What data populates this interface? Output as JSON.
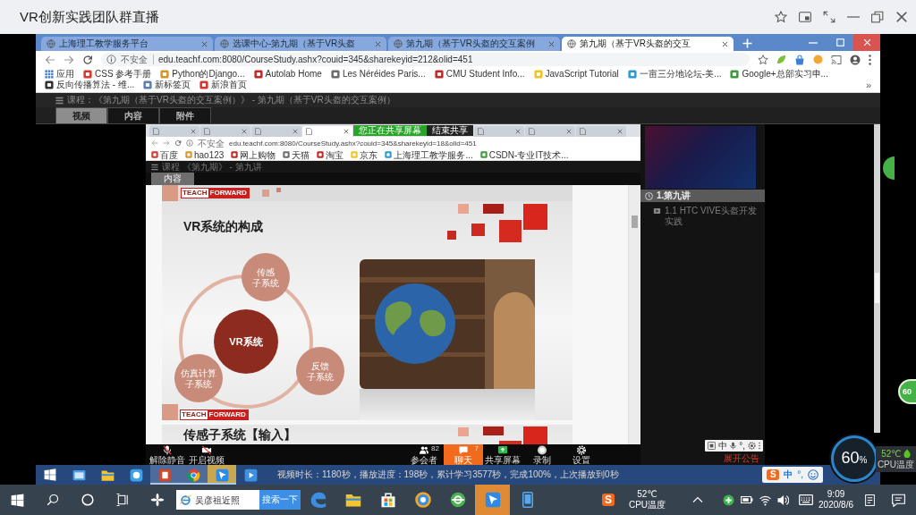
{
  "window": {
    "title": "VR创新实践团队群直播"
  },
  "browser": {
    "tabs": [
      {
        "title": "上海理工教学服务平台",
        "selected": false
      },
      {
        "title": "选课中心-第九期（基于VR头盔",
        "selected": false
      },
      {
        "title": "第九期（基于VR头盔的交互案例",
        "selected": false
      },
      {
        "title": "第九期（基于VR头盔的交互",
        "selected": true
      }
    ],
    "security_label": "不安全",
    "url": "edu.teachf.com:8080/CourseStudy.ashx?couid=345&sharekeyid=212&olid=451",
    "bookmarks": [
      {
        "label": "应用"
      },
      {
        "label": "CSS 参考手册"
      },
      {
        "label": "Python的Django..."
      },
      {
        "label": "Autolab Home"
      },
      {
        "label": "Les Néréides Paris..."
      },
      {
        "label": "CMU Student Info..."
      },
      {
        "label": "JavaScript Tutorial"
      },
      {
        "label": "一亩三分地论坛-美..."
      },
      {
        "label": "Google+总部实习申..."
      },
      {
        "label": "反向传播算法 - 维..."
      },
      {
        "label": "新标签页"
      },
      {
        "label": "新浪首页"
      }
    ],
    "more": "»"
  },
  "course_page": {
    "breadcrumb": "课程：《第九期（基于VR头盔的交互案例）》 - 第九期（基于VR头盔的交互案例）",
    "tabs": [
      {
        "label": "视频",
        "selected": true
      },
      {
        "label": "内容",
        "selected": false
      },
      {
        "label": "附件",
        "selected": false
      }
    ],
    "outline": {
      "chapter": "1.第九讲",
      "lessons": [
        {
          "title": "1.1 HTC VIVE头盔开发实践"
        }
      ]
    },
    "ime_toolbar": {
      "mode": "中",
      "punctuation": "°,"
    },
    "notice_link": "展开公告",
    "progress": "视频时长：1180秒，播放进度：198秒，累计学习3577秒，完成100%，上次播放到0秒"
  },
  "shared_screen": {
    "browser_tabs": [
      {
        "selected": false
      },
      {
        "selected": false
      },
      {
        "selected": false
      },
      {
        "selected": true
      },
      {
        "selected": false
      },
      {
        "selected": false
      },
      {
        "selected": false
      }
    ],
    "share_banner": {
      "text": "您正在共享屏幕",
      "button": "结束共享"
    },
    "security_label": "不安全",
    "url": "edu.teachf.com:8080/CourseStudy.ashx?couid=345&sharekeyid=18&olid=451",
    "bookmarks": [
      {
        "label": "百度"
      },
      {
        "label": "hao123"
      },
      {
        "label": "网上购物"
      },
      {
        "label": "天猫"
      },
      {
        "label": "淘宝"
      },
      {
        "label": "京东"
      },
      {
        "label": "上海理工教学服务..."
      },
      {
        "label": "CSDN-专业IT技术..."
      }
    ],
    "breadcrumb": "课程 《第九期》 - 第九讲",
    "tabs": [
      {
        "label": "内容",
        "selected": true
      }
    ],
    "slides": [
      {
        "header_logo": [
          "TEACH",
          "FORWARD"
        ],
        "title": "VR系统的构成",
        "diagram": {
          "center": "VR系统",
          "nodes": [
            {
              "lines": [
                "传感",
                "子系统"
              ]
            },
            {
              "lines": [
                "仿真计算",
                "子系统"
              ]
            },
            {
              "lines": [
                "反馈",
                "子系统"
              ]
            }
          ]
        },
        "footer_logo": [
          "TEACH",
          "FORWARD"
        ]
      },
      {
        "title": "传感子系统【输入】"
      }
    ]
  },
  "meeting_toolbar": {
    "items": [
      {
        "label": "解除静音",
        "selected": false
      },
      {
        "label": "开启视频",
        "selected": false
      },
      {
        "label": "参会者",
        "count": "82",
        "selected": false
      },
      {
        "label": "聊天",
        "count": "7",
        "selected": true
      },
      {
        "label": "共享屏幕",
        "selected": false
      },
      {
        "label": "录制",
        "selected": false
      },
      {
        "label": "设置",
        "selected": false
      }
    ]
  },
  "inner_taskbar": {
    "apps": [
      {
        "open": false,
        "selected": false
      },
      {
        "open": false,
        "selected": false
      },
      {
        "open": false,
        "selected": false
      },
      {
        "open": true,
        "selected": false
      },
      {
        "open": true,
        "selected": false
      },
      {
        "open": true,
        "selected": true
      },
      {
        "open": false,
        "selected": false
      }
    ],
    "ime": {
      "logo": "S",
      "mode": "中",
      "punctuation": "°,"
    }
  },
  "side_ball": {
    "label": "60"
  },
  "cpu_monitor": {
    "usage": "60",
    "unit": "%",
    "temperature": "52℃",
    "label": "CPU温度"
  },
  "taskbar": {
    "search": {
      "placeholder": "吴彦祖近照",
      "button": "搜索一下"
    },
    "apps": [
      {
        "selected": false
      },
      {
        "selected": false
      },
      {
        "selected": false
      },
      {
        "selected": false
      },
      {
        "selected": false
      },
      {
        "selected": true
      },
      {
        "selected": false
      }
    ],
    "ime_logo": "S",
    "cpu": {
      "temperature": "52℃",
      "label": "CPU温度"
    },
    "clock": {
      "time": "9:09",
      "date": "2020/8/6"
    }
  }
}
